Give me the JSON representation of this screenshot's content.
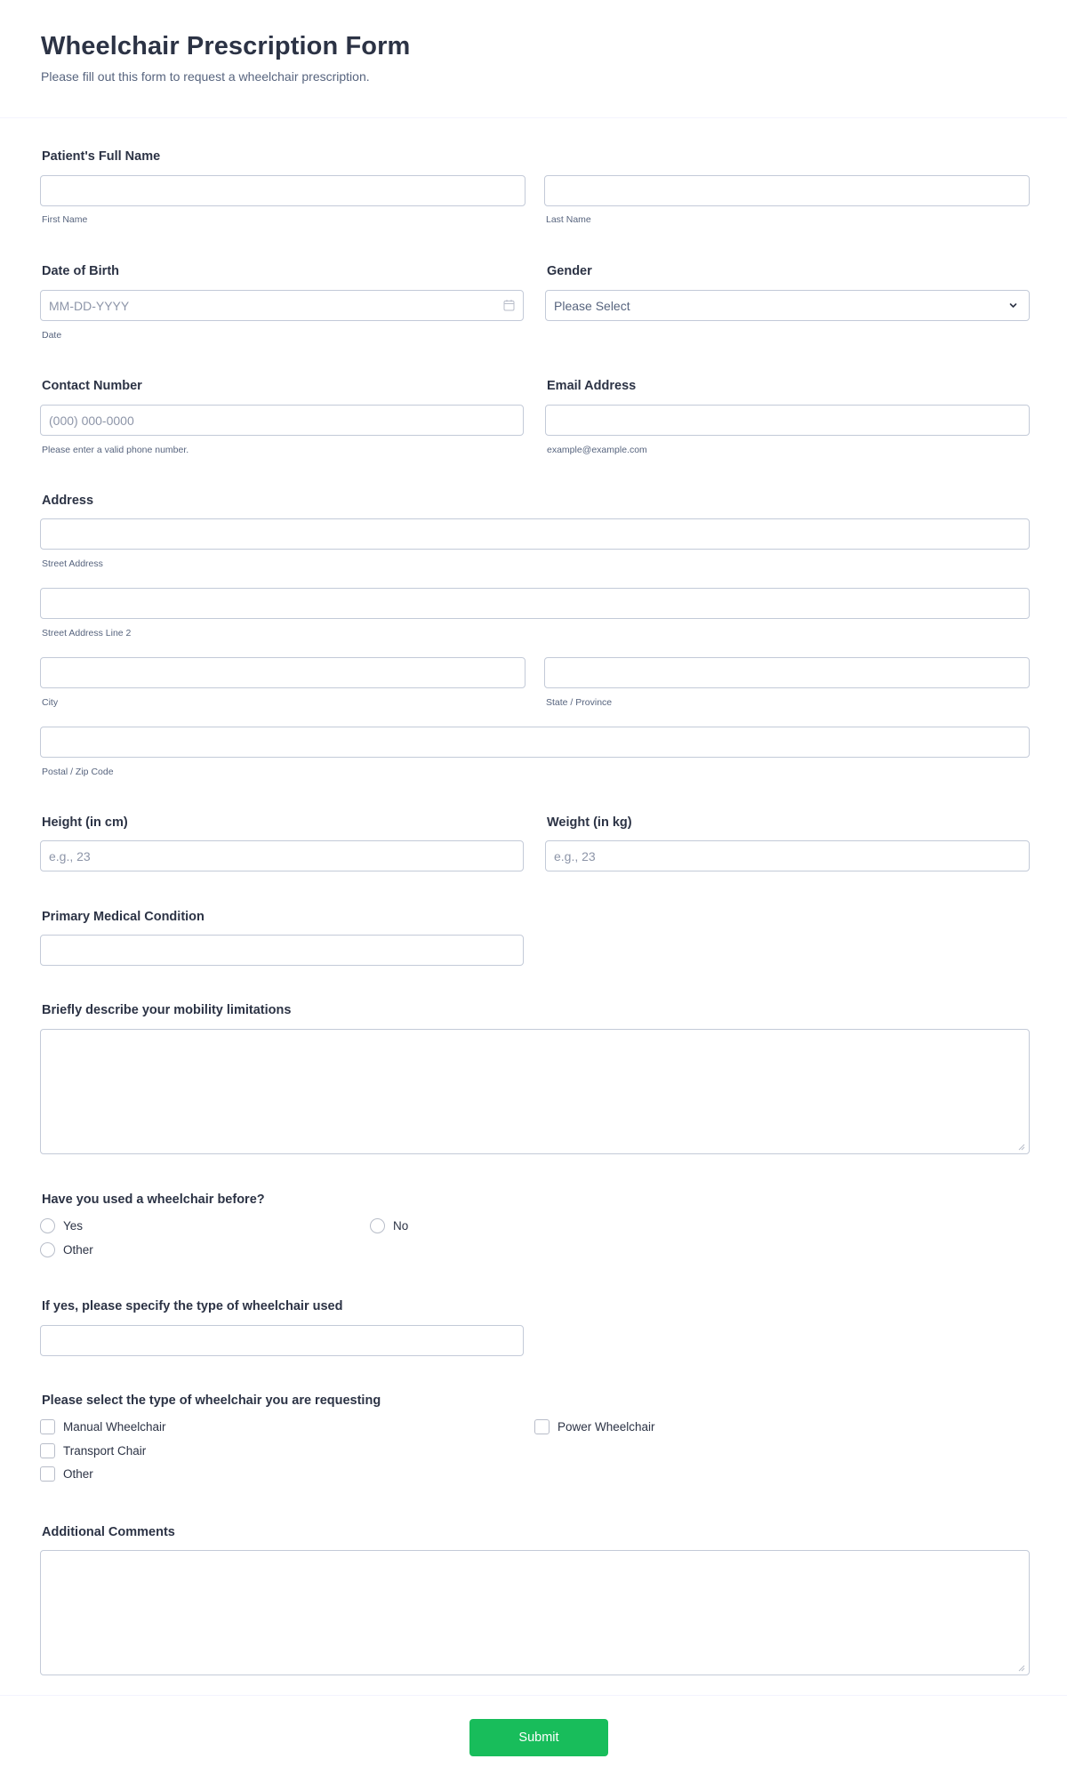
{
  "header": {
    "title": "Wheelchair Prescription Form",
    "subtitle": "Please fill out this form to request a wheelchair prescription."
  },
  "fields": {
    "full_name": {
      "label": "Patient's Full Name",
      "first": {
        "value": "",
        "sublabel": "First Name"
      },
      "last": {
        "value": "",
        "sublabel": "Last Name"
      }
    },
    "dob": {
      "label": "Date of Birth",
      "placeholder": "MM-DD-YYYY",
      "value": "",
      "sublabel": "Date",
      "icon": "calendar-icon"
    },
    "gender": {
      "label": "Gender",
      "selected": "Please Select",
      "icon": "chevron-down-icon"
    },
    "contact": {
      "label": "Contact Number",
      "placeholder": "(000) 000-0000",
      "value": "",
      "sublabel": "Please enter a valid phone number."
    },
    "email": {
      "label": "Email Address",
      "value": "",
      "sublabel": "example@example.com"
    },
    "address": {
      "label": "Address",
      "street": {
        "value": "",
        "sublabel": "Street Address"
      },
      "street2": {
        "value": "",
        "sublabel": "Street Address Line 2"
      },
      "city": {
        "value": "",
        "sublabel": "City"
      },
      "state": {
        "value": "",
        "sublabel": "State / Province"
      },
      "zip": {
        "value": "",
        "sublabel": "Postal / Zip Code"
      }
    },
    "height": {
      "label": "Height (in cm)",
      "placeholder": "e.g., 23",
      "value": ""
    },
    "weight": {
      "label": "Weight (in kg)",
      "placeholder": "e.g., 23",
      "value": ""
    },
    "condition": {
      "label": "Primary Medical Condition",
      "value": ""
    },
    "mobility": {
      "label": "Briefly describe your mobility limitations",
      "value": ""
    },
    "used_before": {
      "label": "Have you used a wheelchair before?",
      "options": [
        {
          "label": "Yes",
          "checked": false
        },
        {
          "label": "No",
          "checked": false
        },
        {
          "label": "Other",
          "checked": false
        }
      ]
    },
    "type_used": {
      "label": "If yes, please specify the type of wheelchair used",
      "value": ""
    },
    "type_requested": {
      "label": "Please select the type of wheelchair you are requesting",
      "options": [
        {
          "label": "Manual Wheelchair",
          "checked": false
        },
        {
          "label": "Power Wheelchair",
          "checked": false
        },
        {
          "label": "Transport Chair",
          "checked": false
        },
        {
          "label": "Other",
          "checked": false
        }
      ]
    },
    "comments": {
      "label": "Additional Comments",
      "value": ""
    }
  },
  "actions": {
    "submit_label": "Submit"
  },
  "colors": {
    "accent": "#18bd5b",
    "text": "#2c3345",
    "muted": "#57647e",
    "border": "#c3cad8"
  }
}
